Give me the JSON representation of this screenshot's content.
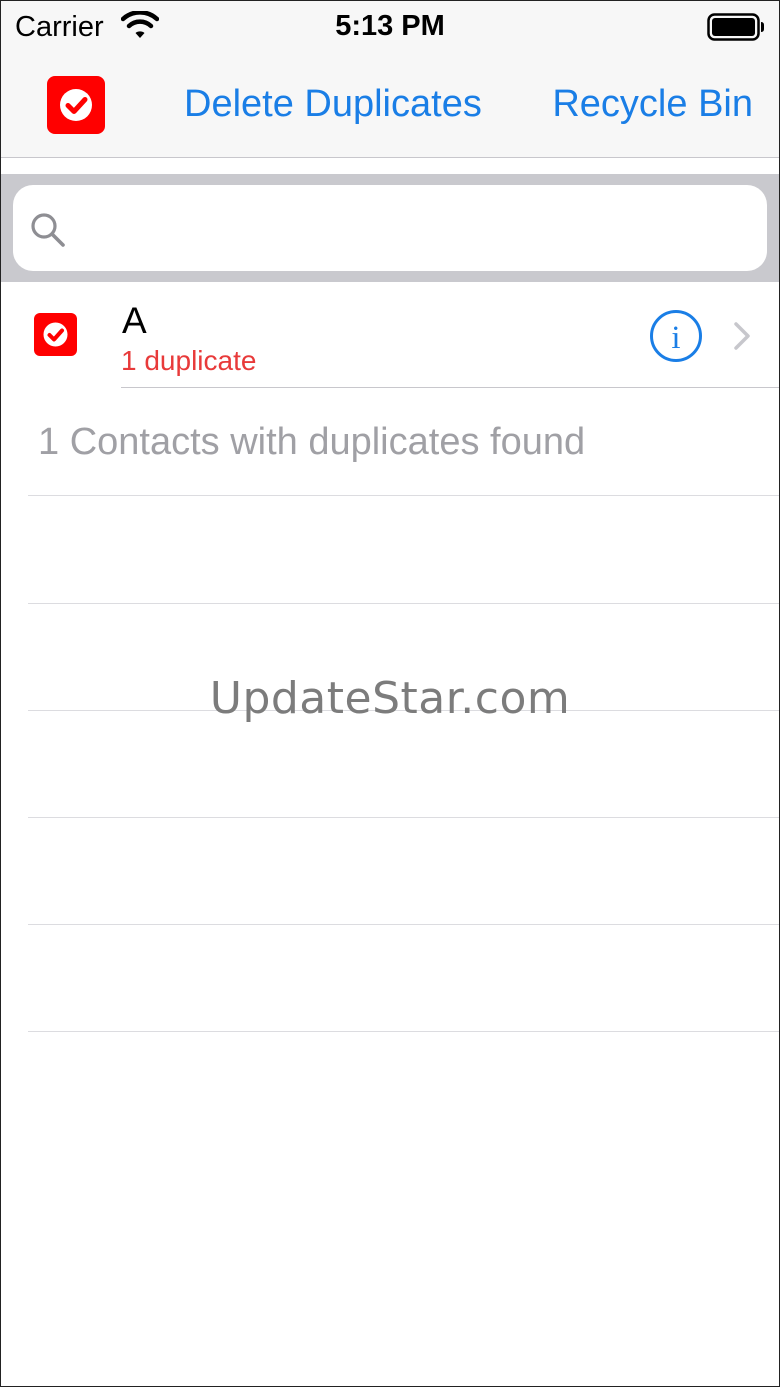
{
  "status_bar": {
    "carrier": "Carrier",
    "time": "5:13 PM"
  },
  "nav": {
    "delete_label": "Delete Duplicates",
    "recycle_label": "Recycle Bin",
    "select_all_checked": true
  },
  "search": {
    "placeholder": "",
    "value": ""
  },
  "contacts": [
    {
      "name": "A",
      "duplicates_label": "1 duplicate",
      "checked": true
    }
  ],
  "summary": "1 Contacts with duplicates found",
  "watermark": "UpdateStar.com",
  "colors": {
    "accent": "#1a7ee6",
    "checkbox": "#ff0000",
    "duplicate_text": "#e83a3a",
    "muted_text": "#a0a0a5"
  },
  "icons": [
    "wifi-icon",
    "battery-icon",
    "select-all-check-icon",
    "search-icon",
    "check-icon",
    "info-icon",
    "chevron-right-icon"
  ]
}
